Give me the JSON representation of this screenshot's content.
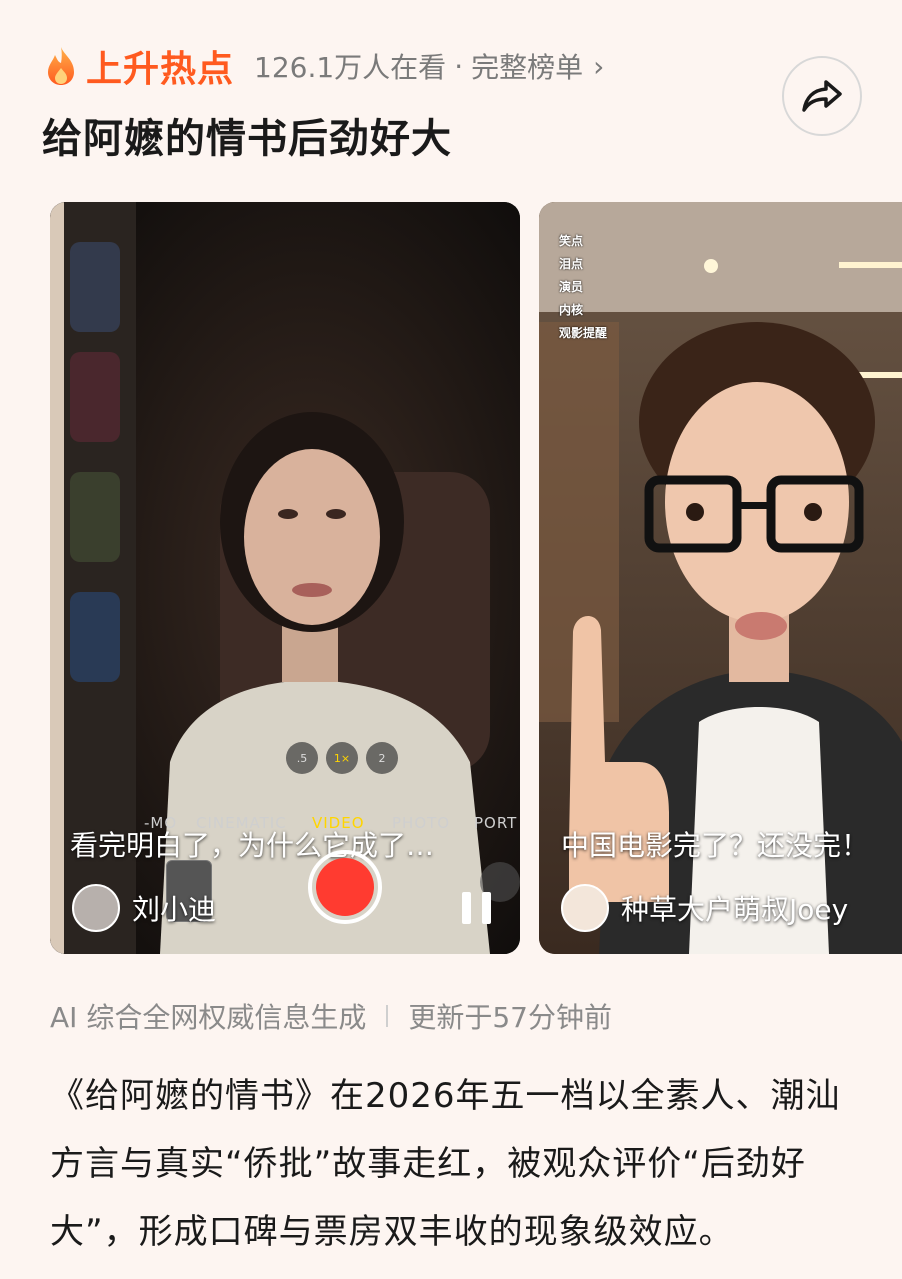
{
  "header": {
    "hot_label": "上升热点",
    "viewers": "126.1万人在看",
    "separator": "·",
    "full_list": "完整榜单",
    "chevron": "›"
  },
  "title": "给阿嬷的情书后劲好大",
  "cards": [
    {
      "caption": "看完明白了，为什么它成了…",
      "author": "刘小迪",
      "camera_modes": [
        "-MO",
        "CINEMATIC",
        "VIDEO",
        "PHOTO",
        "PORT"
      ],
      "zoom_levels": [
        ".5",
        "1×",
        "2"
      ]
    },
    {
      "caption": "中国电影完了？还没完！",
      "author": "种草大户萌叔Joey",
      "side_tags": [
        "笑点",
        "泪点",
        "演员",
        "内核",
        "观影提醒"
      ]
    }
  ],
  "meta": {
    "source": "AI 综合全网权威信息生成",
    "updated": "更新于57分钟前"
  },
  "summary": "《给阿嬷的情书》在2026年五一档以全素人、潮汕方言与真实“侨批”故事走红，被观众评价“后劲好大”，形成口碑与票房双丰收的现象级效应。",
  "colors": {
    "accent": "#ff5a1f",
    "background": "#fdf5f1",
    "record": "#ff3b30",
    "active_mode": "#ffd500"
  }
}
